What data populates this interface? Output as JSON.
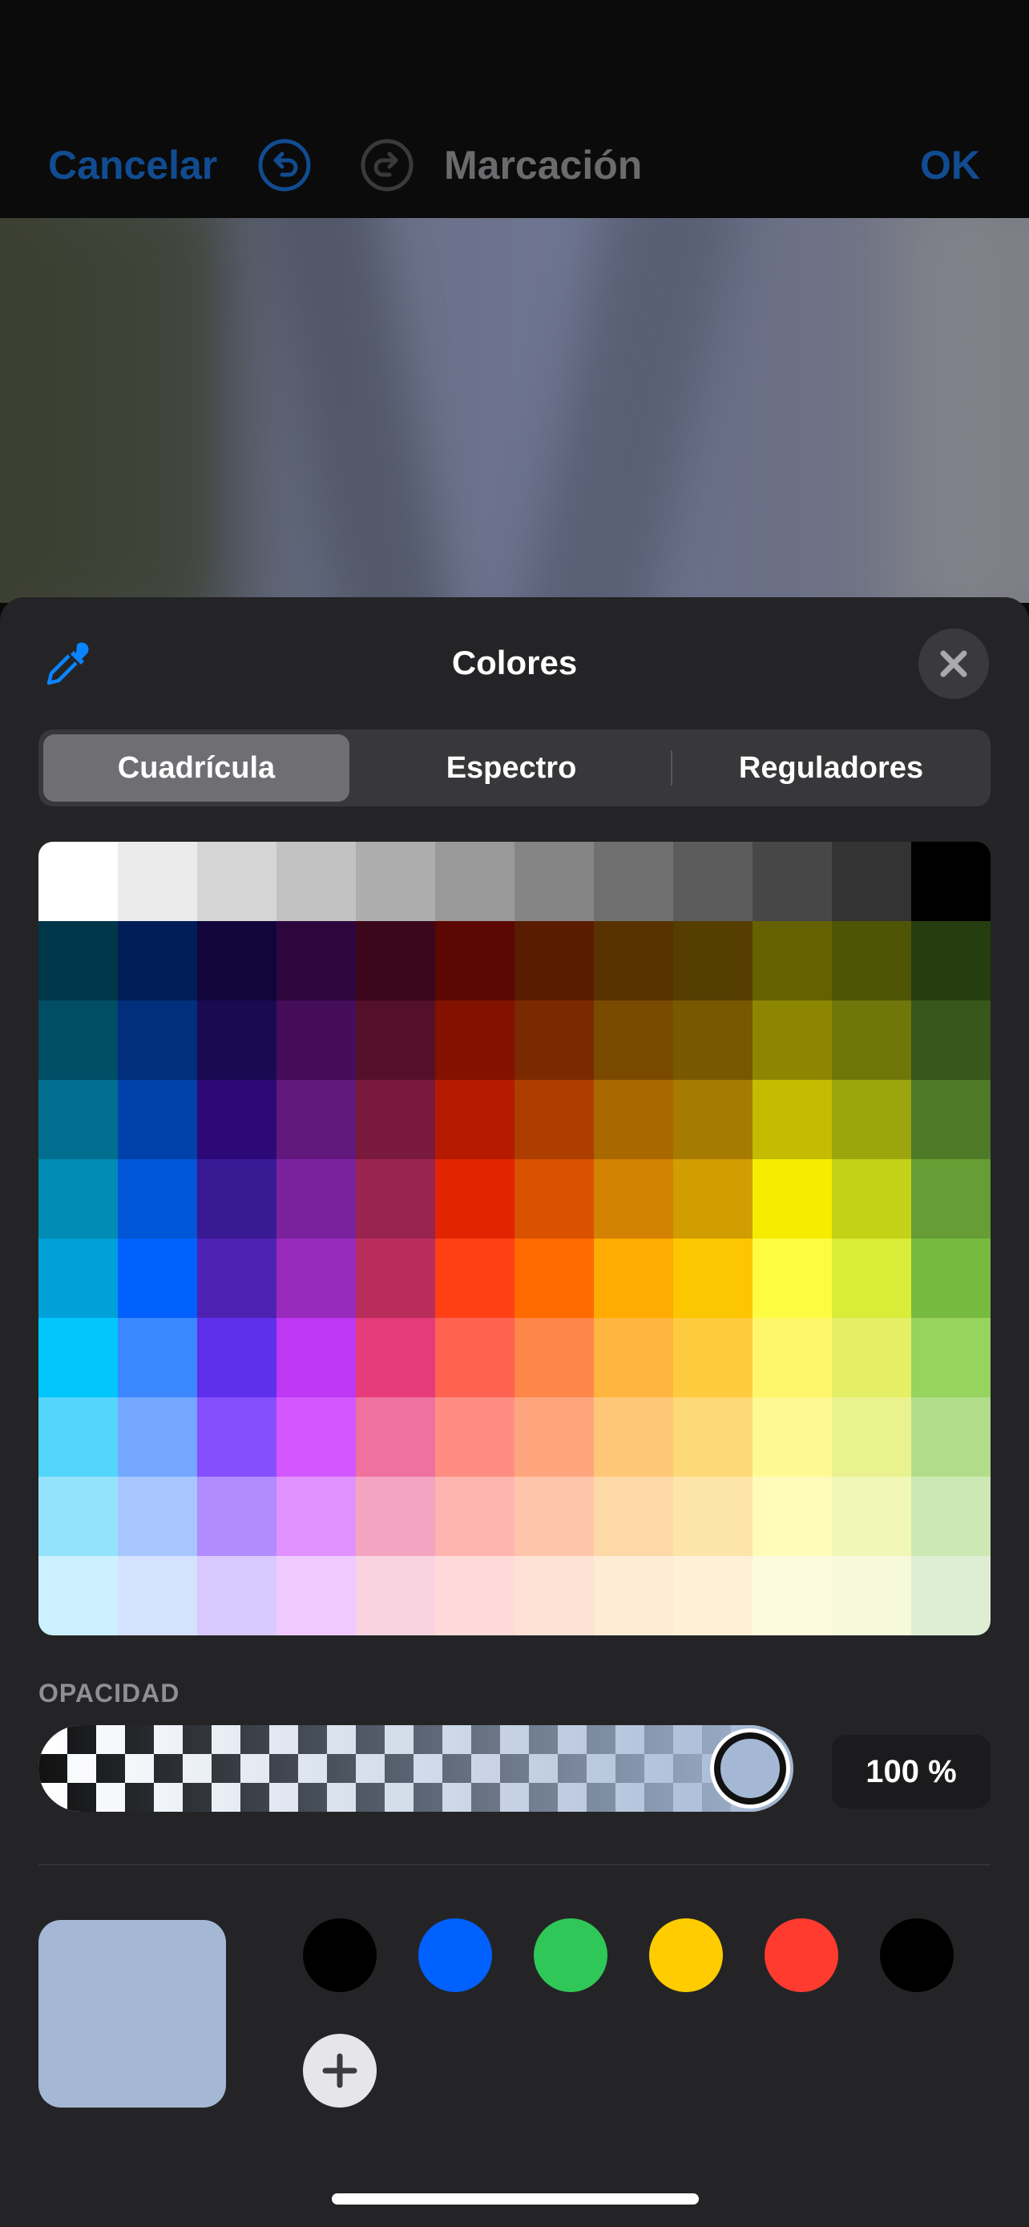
{
  "nav": {
    "cancel_label": "Cancelar",
    "title": "Marcación",
    "ok_label": "OK"
  },
  "sheet": {
    "title": "Colores",
    "tabs": [
      {
        "label": "Cuadrícula",
        "selected": true
      },
      {
        "label": "Espectro",
        "selected": false
      },
      {
        "label": "Reguladores",
        "selected": false
      }
    ],
    "grid_colors": [
      [
        "#ffffff",
        "#ebebeb",
        "#d6d6d6",
        "#c2c2c2",
        "#adadad",
        "#999999",
        "#858585",
        "#707070",
        "#5c5c5c",
        "#474747",
        "#333333",
        "#000000"
      ],
      [
        "#00374a",
        "#011d57",
        "#11053b",
        "#2e063d",
        "#3c071b",
        "#5c0701",
        "#5a1c00",
        "#583300",
        "#563d00",
        "#666100",
        "#4f5504",
        "#263e0f"
      ],
      [
        "#004d65",
        "#012f7b",
        "#1a0a52",
        "#450d59",
        "#551029",
        "#831100",
        "#7b2900",
        "#7a4a00",
        "#785800",
        "#8d8602",
        "#6f760a",
        "#38571a"
      ],
      [
        "#016e8f",
        "#0042a9",
        "#2c0977",
        "#61187c",
        "#791a3d",
        "#b51a00",
        "#ad3e00",
        "#a96800",
        "#a67b01",
        "#c4bc00",
        "#9ba50e",
        "#4e7a27"
      ],
      [
        "#008cb4",
        "#0056d6",
        "#371a94",
        "#7a219e",
        "#99244f",
        "#e22400",
        "#da5100",
        "#d38301",
        "#d19d01",
        "#f5ec00",
        "#c3d117",
        "#669d34"
      ],
      [
        "#00a1d8",
        "#0061fe",
        "#4d22b2",
        "#982abc",
        "#b92d5d",
        "#ff4015",
        "#ff6a00",
        "#ffab01",
        "#fcc700",
        "#fefb41",
        "#d9ec37",
        "#76bb40"
      ],
      [
        "#01c7fc",
        "#3a87fe",
        "#5e30eb",
        "#be38f3",
        "#e63b7a",
        "#fe6250",
        "#fe8648",
        "#feb43f",
        "#fecb3e",
        "#fff76b",
        "#e4ef65",
        "#96d35f"
      ],
      [
        "#52d6fc",
        "#74a7ff",
        "#864ffd",
        "#d357fe",
        "#ee719e",
        "#ff8c82",
        "#fea57d",
        "#fec777",
        "#fed977",
        "#fff994",
        "#eaf28f",
        "#b1dd8b"
      ],
      [
        "#93e3fc",
        "#a7c6ff",
        "#b18cfe",
        "#e292fe",
        "#f4a4c0",
        "#ffb5af",
        "#ffc5ab",
        "#fed9a8",
        "#fde4a8",
        "#fffbb9",
        "#f1f7b7",
        "#cde8b5"
      ],
      [
        "#cbf0ff",
        "#d3e2ff",
        "#d9c9fe",
        "#efcaff",
        "#f9d3e0",
        "#ffdad8",
        "#ffe2d6",
        "#feecd4",
        "#fef1d5",
        "#fdfbdd",
        "#f6fadb",
        "#deeed4"
      ]
    ],
    "opacity": {
      "label": "OPACIDAD",
      "value_text": "100 %",
      "value_fraction": 1.0,
      "color": "#a4b7d4"
    },
    "current_color": "#a4b7d4",
    "saved_colors": [
      "#000000",
      "#0061fe",
      "#30c759",
      "#ffcc00",
      "#ff3b30",
      "#000000"
    ]
  },
  "colors": {
    "accent_blue": "#114c91",
    "eyedropper_blue": "#0a84ff"
  }
}
